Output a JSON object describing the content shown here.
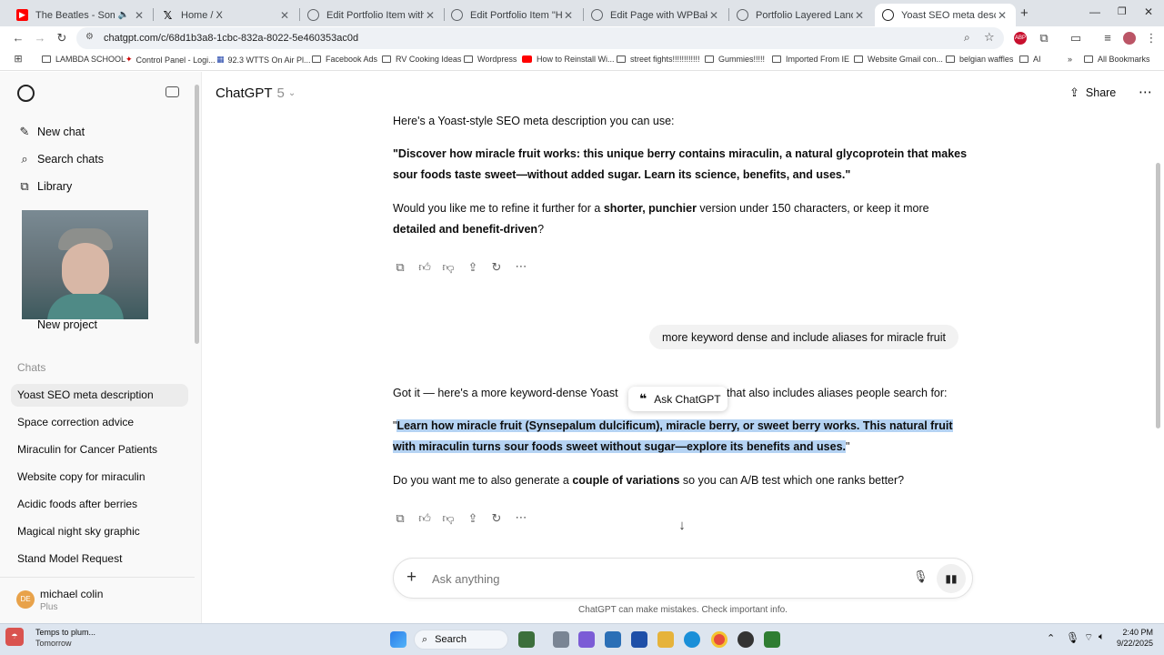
{
  "browser": {
    "tabs": [
      {
        "title": "The Beatles - Something - Y",
        "icon": "youtube-icon",
        "color": "#ff0000"
      },
      {
        "title": "Home / X",
        "icon": "x-logo-icon",
        "color": "#000000"
      },
      {
        "title": "Edit Portfolio Item with WPBakery",
        "icon": "globe-icon",
        "color": "#5f6368"
      },
      {
        "title": "Edit Portfolio Item \"How it works\"",
        "icon": "globe-icon",
        "color": "#5f6368"
      },
      {
        "title": "Edit Page with WPBakery Page",
        "icon": "globe-icon",
        "color": "#5f6368"
      },
      {
        "title": "Portfolio Layered Landing - mi",
        "icon": "globe-icon",
        "color": "#5f6368"
      },
      {
        "title": "Yoast SEO meta description",
        "icon": "chatgpt-icon",
        "color": "#000000"
      }
    ],
    "url": "chatgpt.com/c/68d1b3a8-1cbc-832a-8022-5e460353ac0d",
    "bookmarks": [
      "LAMBDA SCHOOL",
      "Control Panel - Logi...",
      "92.3 WTTS On Air Pl...",
      "Facebook Ads",
      "RV Cooking Ideas",
      "Wordpress",
      "How to Reinstall Wi...",
      "street fights!!!!!!!!!!!!",
      "Gummies!!!!!",
      "Imported From IE",
      "Website Gmail con...",
      "belgian waffles",
      "AI"
    ],
    "all_bookmarks": "All Bookmarks"
  },
  "sidebar": {
    "new_chat": "New chat",
    "search_chats": "Search chats",
    "library": "Library",
    "new_project": "New project",
    "chats_heading": "Chats",
    "chats": [
      "Yoast SEO meta description",
      "Space correction advice",
      "Miraculin for Cancer Patients",
      "Website copy for miraculin",
      "Acidic foods after berries",
      "Magical night sky graphic",
      "Stand Model Request"
    ],
    "user": {
      "initials": "DE",
      "name": "michael colin",
      "plan": "Plus",
      "avatar_color": "#e8a24a"
    }
  },
  "header": {
    "model": "ChatGPT",
    "version": "5",
    "share": "Share"
  },
  "conversation": {
    "intro": "Here's a Yoast-style SEO meta description you can use:",
    "meta1": "\"Discover how miracle fruit works: this unique berry contains miraculin, a natural glycoprotein that makes sour foods taste sweet—without added sugar. Learn its science, benefits, and uses.\"",
    "meta1_line1": "\"Discover how miracle fruit works: this unique berry contains miraculin, a natural glycoprotein that makes",
    "meta1_line2": "sour foods taste sweet—without added sugar. Learn its science, benefits, and uses.\"",
    "refine_a": "Would you like me to refine it further for a ",
    "refine_b": "shorter, punchier",
    "refine_c": " version under 150 characters, or keep it more",
    "refine_d": "detailed and benefit-driven",
    "refine_e": "?",
    "user_message": "more keyword dense and include aliases for miracle fruit",
    "reply_a": "Got it — here's a more keyword-dense Yoast",
    "reply_b": "that also includes aliases people search for:",
    "ask_chatgpt": "Ask ChatGPT",
    "meta2_quote_open": "\"",
    "meta2_line1": "Learn how miracle fruit (Synsepalum dulcificum), miracle berry, or sweet berry works. This natural fruit",
    "meta2_line2": "with miraculin turns sour foods sweet without sugar—explore its benefits and uses.",
    "meta2_quote_close": "\"",
    "followup_a": "Do you want me to also generate a ",
    "followup_b": "couple of variations",
    "followup_c": " so you can A/B test which one ranks better?"
  },
  "composer": {
    "placeholder": "Ask anything",
    "disclaimer": "ChatGPT can make mistakes. Check important info."
  },
  "taskbar": {
    "weather_title": "Temps to plum...",
    "weather_sub": "Tomorrow",
    "search": "Search",
    "time": "2:40 PM",
    "date": "9/22/2025"
  },
  "colors": {
    "selection": "#b5d3f3",
    "accent": "#0d0d0d"
  }
}
